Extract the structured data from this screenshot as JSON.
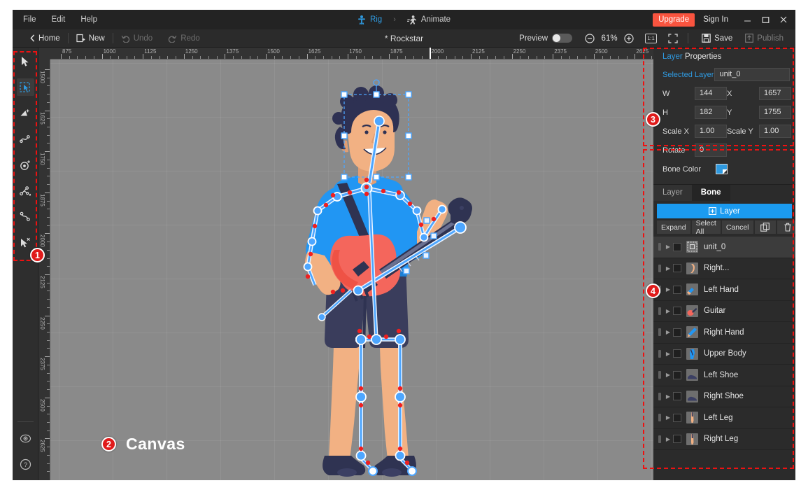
{
  "window": {
    "menus": [
      "File",
      "Edit",
      "Help"
    ],
    "modes": [
      {
        "label": "Rig",
        "icon": "person-icon",
        "active": true
      },
      {
        "label": "Animate",
        "icon": "running-person-icon",
        "active": false
      }
    ],
    "mode_separator": "›",
    "upgrade_label": "Upgrade",
    "signin_label": "Sign In",
    "minimize_glyph": "–",
    "maximize_glyph": "❐",
    "close_glyph": "✕"
  },
  "toolbar": {
    "home_label": "Home",
    "new_label": "New",
    "undo_label": "Undo",
    "redo_label": "Redo",
    "doc_title": "* Rockstar",
    "preview_label": "Preview",
    "zoom_out": "⊖",
    "zoom_value": "61%",
    "zoom_in": "⊕",
    "actual_size_label": "1:1",
    "fullscreen_label": "fullscreen-icon",
    "save_label": "Save",
    "publish_label": "Publish"
  },
  "tools": [
    {
      "name": "select-arrow-tool",
      "selected": false
    },
    {
      "name": "marquee-select-tool",
      "selected": true
    },
    {
      "name": "add-shape-tool",
      "selected": false
    },
    {
      "name": "curve-tool",
      "selected": false
    },
    {
      "name": "add-pivot-tool",
      "selected": false
    },
    {
      "name": "bone-tool",
      "selected": false
    },
    {
      "name": "bendable-bone-tool",
      "selected": false
    },
    {
      "name": "delete-point-tool",
      "selected": false
    },
    {
      "name": "visibility-eye-tool",
      "selected": false
    },
    {
      "name": "help-tool",
      "selected": false
    }
  ],
  "canvas": {
    "label": "Canvas",
    "ruler_h": [
      "875",
      "1000",
      "1125",
      "1250",
      "1375",
      "1500",
      "1625",
      "1750",
      "1875",
      "2000",
      "2125",
      "2250",
      "2375",
      "2500",
      "2625"
    ],
    "ruler_v": [
      "1500",
      "1625",
      "1750",
      "1875",
      "2000",
      "2125",
      "2250",
      "2375",
      "2500",
      "2625"
    ],
    "colors": {
      "background": "#8a8a8a",
      "shirt": "#2196f3",
      "skin": "#f0ad7f",
      "hair": "#2e3153",
      "guitar": "#f4665c",
      "shorts": "#3a3d5c",
      "bone": "#4da6ff"
    }
  },
  "properties": {
    "title_blue": "Layer",
    "title_white": " Properties",
    "selected_layer_label": "Selected Layer",
    "selected_layer_value": "unit_0",
    "w_label": "W",
    "w_value": "144",
    "x_label": "X",
    "x_value": "1657",
    "h_label": "H",
    "h_value": "182",
    "y_label": "Y",
    "y_value": "1755",
    "scale_x_label": "Scale X",
    "scale_x_value": "1.00",
    "scale_y_label": "Scale Y",
    "scale_y_value": "1.00",
    "rotate_label": "Rotate",
    "rotate_value": "0",
    "bone_color_label": "Bone Color",
    "bone_color_value": "#2f9ae0"
  },
  "layers": {
    "tabs": [
      {
        "label": "Layer",
        "active": false
      },
      {
        "label": "Bone",
        "active": true
      }
    ],
    "add_label": "Layer",
    "buttons": [
      {
        "label": "Expand",
        "name": "expand-button"
      },
      {
        "label": "Select All",
        "name": "select-all-button"
      },
      {
        "label": "Cancel",
        "name": "cancel-button"
      },
      {
        "label": "",
        "name": "duplicate-button"
      },
      {
        "label": "",
        "name": "delete-button"
      }
    ],
    "items": [
      {
        "name": "unit_0",
        "selected": true,
        "thumb": "group"
      },
      {
        "name": "Right...",
        "selected": false,
        "thumb": "arm"
      },
      {
        "name": "Left Hand",
        "selected": false,
        "thumb": "hand"
      },
      {
        "name": "Guitar",
        "selected": false,
        "thumb": "guitar"
      },
      {
        "name": "Right Hand",
        "selected": false,
        "thumb": "hand2"
      },
      {
        "name": "Upper Body",
        "selected": false,
        "thumb": "body"
      },
      {
        "name": "Left Shoe",
        "selected": false,
        "thumb": "shoe"
      },
      {
        "name": "Right Shoe",
        "selected": false,
        "thumb": "shoe"
      },
      {
        "name": "Left Leg",
        "selected": false,
        "thumb": "leg"
      },
      {
        "name": "Right Leg",
        "selected": false,
        "thumb": "leg"
      }
    ]
  },
  "annotations": [
    {
      "number": "1",
      "target": "tool-rail"
    },
    {
      "number": "2",
      "target": "canvas"
    },
    {
      "number": "3",
      "target": "layer-properties"
    },
    {
      "number": "4",
      "target": "layer-list"
    }
  ]
}
